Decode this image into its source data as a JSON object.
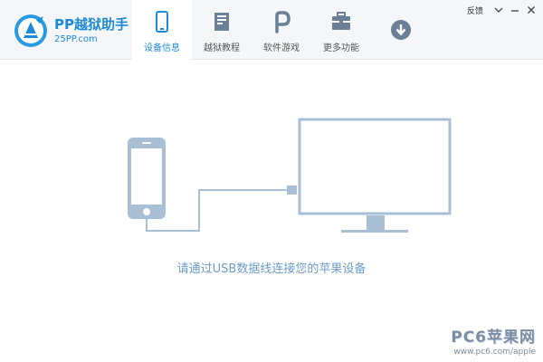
{
  "app": {
    "name": "PP越狱助手",
    "site": "25PP.com"
  },
  "tabs": [
    {
      "label": "设备信息",
      "icon": "phone-icon",
      "active": true
    },
    {
      "label": "越狱教程",
      "icon": "book-icon",
      "active": false
    },
    {
      "label": "软件游戏",
      "icon": "pp-app-icon",
      "active": false
    },
    {
      "label": "更多功能",
      "icon": "toolbox-icon",
      "active": false
    }
  ],
  "toolbar": {
    "download_icon": "download-icon"
  },
  "window_controls": {
    "feedback_label": "反馈",
    "menu_icon": "menu-arrow-icon",
    "minimize_icon": "minimize-icon",
    "close_icon": "close-icon"
  },
  "main": {
    "prompt": "请通过USB数据线连接您的苹果设备"
  },
  "watermark": {
    "title": "PC6苹果网",
    "url": "www.pc6.com/apple"
  },
  "colors": {
    "accent": "#1d8ad8",
    "illustration": "#a8bfd6",
    "prompt_text": "#6e9cc8",
    "topbar_bg": "#f4f6f8",
    "tab_icon": "#6b7f96"
  }
}
